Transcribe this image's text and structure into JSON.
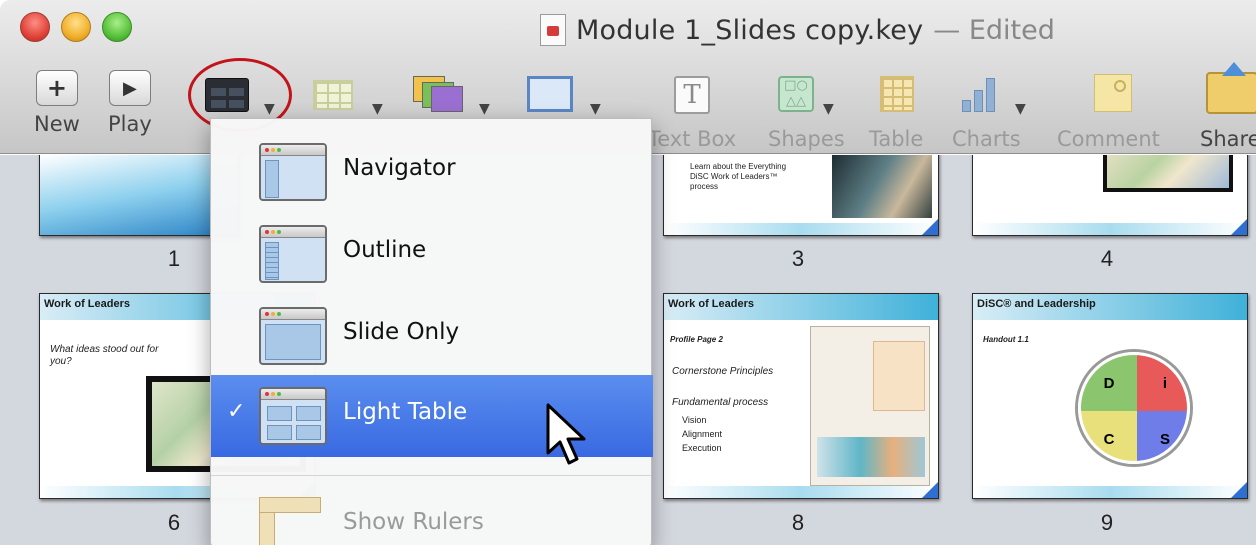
{
  "window": {
    "title": "Module 1_Slides copy.key",
    "edited_suffix": "— Edited"
  },
  "toolbar": {
    "new_label": "New",
    "new_icon": "+",
    "play_label": "Play",
    "play_icon": "▶",
    "view_icon": "view-icon",
    "masters_icon": "masters-icon",
    "themes_icon": "themes-icon",
    "slide_size_icon": "slide-size-icon",
    "textbox_label": "Text Box",
    "textbox_icon": "T",
    "shapes_label": "Shapes",
    "shapes_icon": "□○\n△△",
    "table_label": "Table",
    "charts_label": "Charts",
    "comment_label": "Comment",
    "share_label": "Share"
  },
  "view_menu": {
    "items": [
      {
        "label": "Navigator",
        "selected": false
      },
      {
        "label": "Outline",
        "selected": false
      },
      {
        "label": "Slide Only",
        "selected": false
      },
      {
        "label": "Light Table",
        "selected": true,
        "check": "✓"
      },
      {
        "label": "Show Rulers",
        "disabled": true
      }
    ]
  },
  "slides": [
    {
      "number": "1"
    },
    {
      "number": "3",
      "bullet_text": "Learn about the Everything DiSC Work of Leaders™ process"
    },
    {
      "number": "4"
    },
    {
      "number": "6",
      "title": "Work of Leaders",
      "body": "What ideas stood out for you?"
    },
    {
      "number": "8",
      "title": "Work of Leaders",
      "subtitle": "Profile Page 2",
      "line1": "Cornerstone Principles",
      "line2": "Fundamental process",
      "bullets": [
        "Vision",
        "Alignment",
        "Execution"
      ]
    },
    {
      "number": "9",
      "title": "DiSC® and Leadership",
      "subtitle": "Handout 1.1",
      "quadrants": [
        "D",
        "i",
        "C",
        "S"
      ]
    }
  ],
  "colors": {
    "selection": "#3f6fe4",
    "annotation_circle": "#c2141b",
    "light_table_bg": "#d3d7de"
  }
}
